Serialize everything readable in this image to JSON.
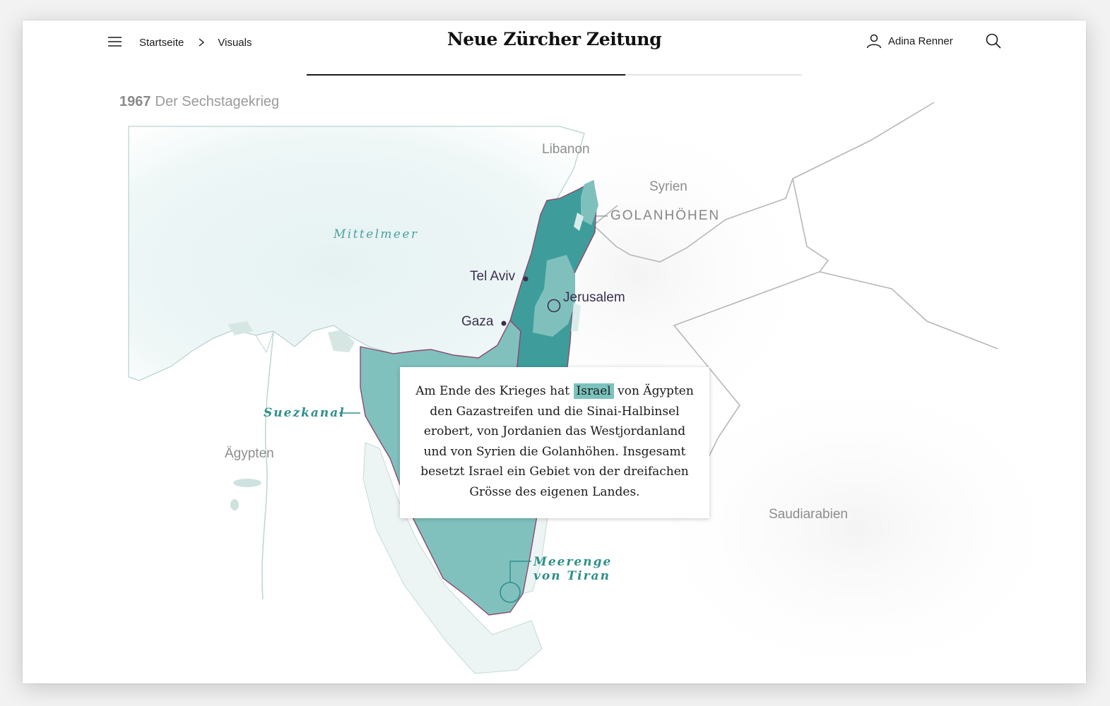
{
  "header": {
    "breadcrumb": [
      "Startseite",
      "Visuals"
    ],
    "logo": "Neue Zürcher Zeitung",
    "user_name": "Adina Renner",
    "reading_progress": 0.643
  },
  "map": {
    "year": "1967",
    "title": "Der Sechstagekrieg",
    "labels": {
      "libanon": "Libanon",
      "syrien": "Syrien",
      "golan": "GOLANHÖHEN",
      "mittelmeer": "Mittelmeer",
      "tel_aviv": "Tel Aviv",
      "jerusalem": "Jerusalem",
      "gaza": "Gaza",
      "suezkanal": "Suezkanal",
      "aegypten": "Ägypten",
      "saudiarabien": "Saudiarabien",
      "tiran_1": "Meerenge",
      "tiran_2": "von Tiran"
    },
    "colors": {
      "sea": "#eaf4f4",
      "israel": "#3f9e9c",
      "occupied": "#7fc0bd",
      "border": "#8c4a6e",
      "highlight": "#7bc3bd"
    }
  },
  "card": {
    "before": "Am Ende des Krieges hat ",
    "highlight": "Israel",
    "after": " von Ägypten den Gazastreifen und die Sinai-Halbinsel erobert, von Jordanien das Westjordanland und von Syrien die Golanhöhen. Insgesamt besetzt Israel ein Gebiet von der dreifachen Grösse des eigenen Landes."
  }
}
